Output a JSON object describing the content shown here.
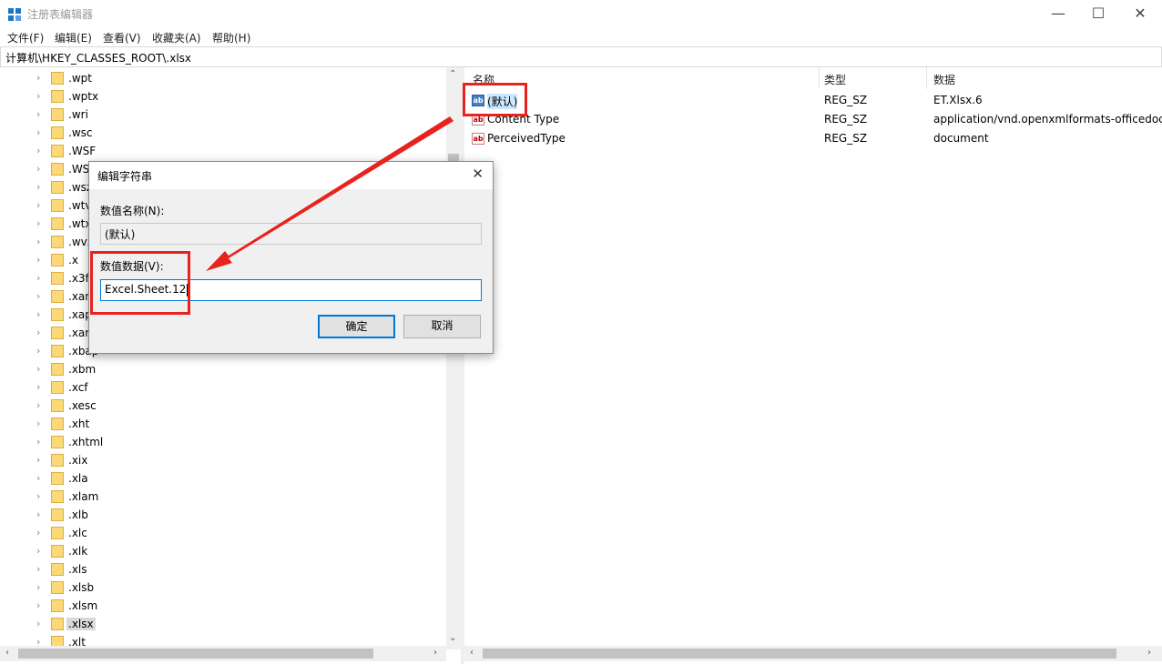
{
  "window": {
    "title": "注册表编辑器",
    "controls": {
      "minimize": "—",
      "maximize": "☐",
      "close": "✕"
    }
  },
  "menu": [
    "文件(F)",
    "编辑(E)",
    "查看(V)",
    "收藏夹(A)",
    "帮助(H)"
  ],
  "address": "计算机\\HKEY_CLASSES_ROOT\\.xlsx",
  "tree": {
    "items": [
      ".wpt",
      ".wptx",
      ".wri",
      ".wsc",
      ".WSF",
      ".WS",
      ".wsz",
      ".wtv",
      ".wtx",
      ".wvx",
      ".x",
      ".x3f",
      ".xam",
      ".xap",
      ".xar",
      ".xbap",
      ".xbm",
      ".xcf",
      ".xesc",
      ".xht",
      ".xhtml",
      ".xix",
      ".xla",
      ".xlam",
      ".xlb",
      ".xlc",
      ".xlk",
      ".xls",
      ".xlsb",
      ".xlsm",
      ".xlsx",
      ".xlt"
    ],
    "selected": ".xlsx"
  },
  "list": {
    "columns": {
      "name": "名称",
      "type": "类型",
      "data": "数据"
    },
    "rows": [
      {
        "name": "(默认)",
        "type": "REG_SZ",
        "data": "ET.Xlsx.6",
        "icon": "string-value-icon"
      },
      {
        "name": "Content Type",
        "type": "REG_SZ",
        "data": "application/vnd.openxmlformats-officedoc",
        "icon": "string-value-icon"
      },
      {
        "name": "PerceivedType",
        "type": "REG_SZ",
        "data": "document",
        "icon": "string-value-icon"
      }
    ]
  },
  "dialog": {
    "title": "编辑字符串",
    "name_label": "数值名称(N):",
    "name_value": "(默认)",
    "data_label": "数值数据(V):",
    "data_value": "Excel.Sheet.12",
    "ok_label": "确定",
    "cancel_label": "取消",
    "close_glyph": "✕"
  },
  "annotation_color": "#e8231f"
}
